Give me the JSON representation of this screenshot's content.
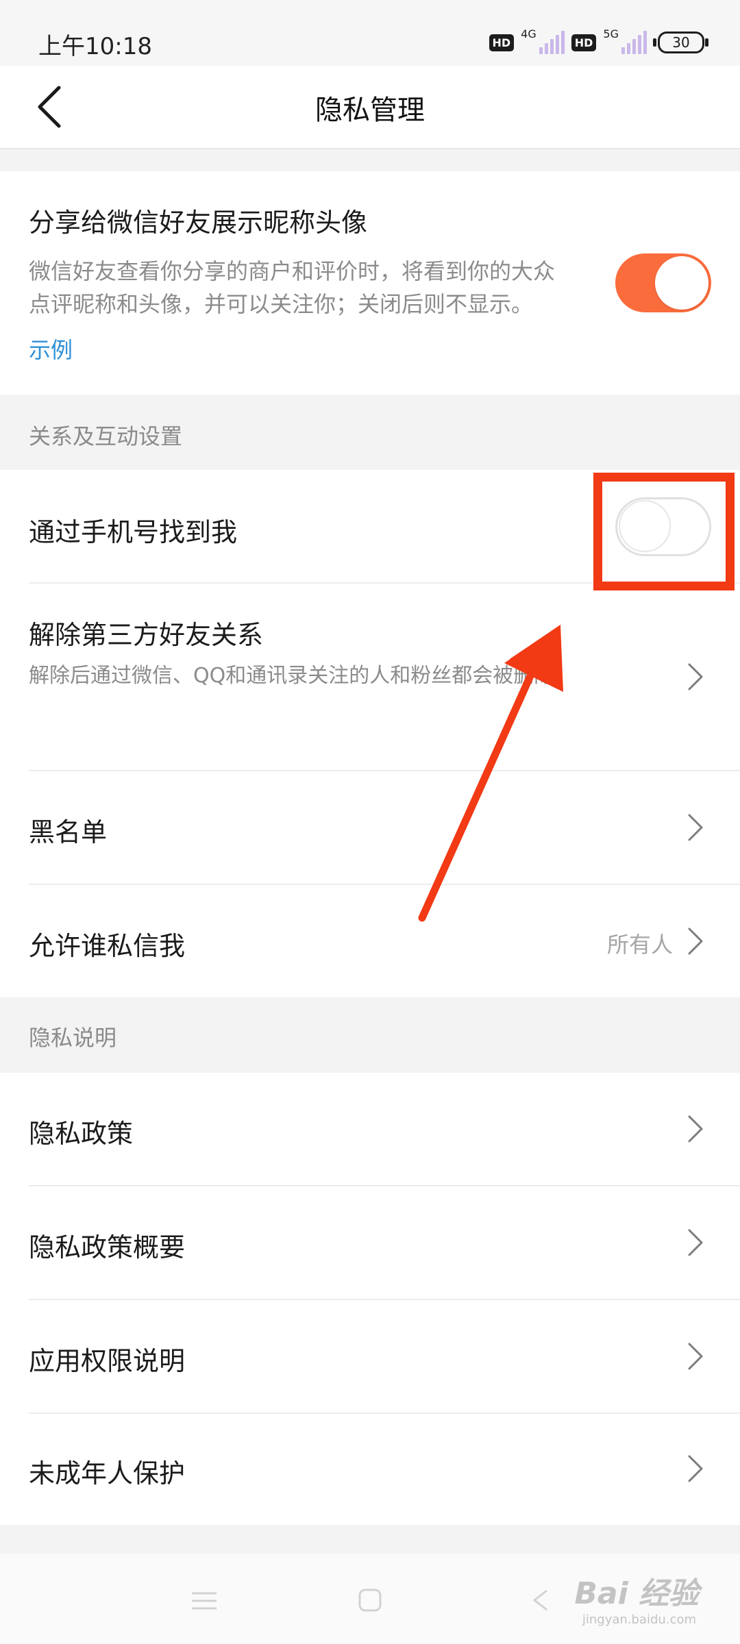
{
  "status_bar": {
    "time": "上午10:18",
    "hd_label": "HD",
    "network_1": "4G",
    "network_2": "5G",
    "battery": "30"
  },
  "nav": {
    "title": "隐私管理",
    "back_icon": "chevron-left-icon"
  },
  "share_setting": {
    "title": "分享给微信好友展示昵称头像",
    "description": "微信好友查看你分享的商户和评价时，将看到你的大众点评昵称和头像，并可以关注你；关闭后则不显示。",
    "example_link": "示例",
    "enabled": true,
    "accent_color": "#fb6c3d"
  },
  "relationship_section": {
    "header": "关系及互动设置",
    "find_by_phone": {
      "label": "通过手机号找到我",
      "enabled": false
    },
    "unbind_third_party": {
      "label": "解除第三方好友关系",
      "description": "解除后通过微信、QQ和通讯录关注的人和粉丝都会被删除"
    },
    "blacklist": {
      "label": "黑名单"
    },
    "who_can_message": {
      "label": "允许谁私信我",
      "value": "所有人"
    }
  },
  "privacy_section": {
    "header": "隐私说明",
    "items": [
      {
        "label": "隐私政策"
      },
      {
        "label": "隐私政策概要"
      },
      {
        "label": "应用权限说明"
      },
      {
        "label": "未成年人保护"
      }
    ]
  },
  "annotation": {
    "highlight_color": "#f23a15"
  },
  "watermark": {
    "text": "Bai 经验",
    "sub": "jingyan.baidu.com"
  },
  "icons": {
    "chevron": "chevron-right-icon",
    "menu": "menu-icon",
    "home": "home-icon",
    "back": "back-icon"
  }
}
